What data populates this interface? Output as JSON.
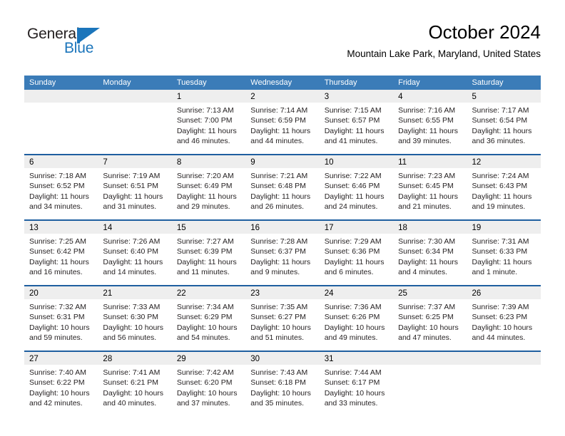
{
  "brand": {
    "name_part1": "General",
    "name_part2": "Blue",
    "flag_icon": "general-blue-flag-logo",
    "color_dark": "#231f20",
    "color_blue": "#1b75bb"
  },
  "header": {
    "title": "October 2024",
    "subtitle": "Mountain Lake Park, Maryland, United States"
  },
  "theme": {
    "header_blue": "#3b7cb8",
    "row_divider_blue": "#1f5fa0",
    "day_strip_gray": "#eeeeee"
  },
  "weekdays": [
    "Sunday",
    "Monday",
    "Tuesday",
    "Wednesday",
    "Thursday",
    "Friday",
    "Saturday"
  ],
  "weeks": [
    [
      {
        "day": "",
        "sunrise": "",
        "sunset": "",
        "daylight_1": "",
        "daylight_2": ""
      },
      {
        "day": "",
        "sunrise": "",
        "sunset": "",
        "daylight_1": "",
        "daylight_2": ""
      },
      {
        "day": "1",
        "sunrise": "Sunrise: 7:13 AM",
        "sunset": "Sunset: 7:00 PM",
        "daylight_1": "Daylight: 11 hours",
        "daylight_2": "and 46 minutes."
      },
      {
        "day": "2",
        "sunrise": "Sunrise: 7:14 AM",
        "sunset": "Sunset: 6:59 PM",
        "daylight_1": "Daylight: 11 hours",
        "daylight_2": "and 44 minutes."
      },
      {
        "day": "3",
        "sunrise": "Sunrise: 7:15 AM",
        "sunset": "Sunset: 6:57 PM",
        "daylight_1": "Daylight: 11 hours",
        "daylight_2": "and 41 minutes."
      },
      {
        "day": "4",
        "sunrise": "Sunrise: 7:16 AM",
        "sunset": "Sunset: 6:55 PM",
        "daylight_1": "Daylight: 11 hours",
        "daylight_2": "and 39 minutes."
      },
      {
        "day": "5",
        "sunrise": "Sunrise: 7:17 AM",
        "sunset": "Sunset: 6:54 PM",
        "daylight_1": "Daylight: 11 hours",
        "daylight_2": "and 36 minutes."
      }
    ],
    [
      {
        "day": "6",
        "sunrise": "Sunrise: 7:18 AM",
        "sunset": "Sunset: 6:52 PM",
        "daylight_1": "Daylight: 11 hours",
        "daylight_2": "and 34 minutes."
      },
      {
        "day": "7",
        "sunrise": "Sunrise: 7:19 AM",
        "sunset": "Sunset: 6:51 PM",
        "daylight_1": "Daylight: 11 hours",
        "daylight_2": "and 31 minutes."
      },
      {
        "day": "8",
        "sunrise": "Sunrise: 7:20 AM",
        "sunset": "Sunset: 6:49 PM",
        "daylight_1": "Daylight: 11 hours",
        "daylight_2": "and 29 minutes."
      },
      {
        "day": "9",
        "sunrise": "Sunrise: 7:21 AM",
        "sunset": "Sunset: 6:48 PM",
        "daylight_1": "Daylight: 11 hours",
        "daylight_2": "and 26 minutes."
      },
      {
        "day": "10",
        "sunrise": "Sunrise: 7:22 AM",
        "sunset": "Sunset: 6:46 PM",
        "daylight_1": "Daylight: 11 hours",
        "daylight_2": "and 24 minutes."
      },
      {
        "day": "11",
        "sunrise": "Sunrise: 7:23 AM",
        "sunset": "Sunset: 6:45 PM",
        "daylight_1": "Daylight: 11 hours",
        "daylight_2": "and 21 minutes."
      },
      {
        "day": "12",
        "sunrise": "Sunrise: 7:24 AM",
        "sunset": "Sunset: 6:43 PM",
        "daylight_1": "Daylight: 11 hours",
        "daylight_2": "and 19 minutes."
      }
    ],
    [
      {
        "day": "13",
        "sunrise": "Sunrise: 7:25 AM",
        "sunset": "Sunset: 6:42 PM",
        "daylight_1": "Daylight: 11 hours",
        "daylight_2": "and 16 minutes."
      },
      {
        "day": "14",
        "sunrise": "Sunrise: 7:26 AM",
        "sunset": "Sunset: 6:40 PM",
        "daylight_1": "Daylight: 11 hours",
        "daylight_2": "and 14 minutes."
      },
      {
        "day": "15",
        "sunrise": "Sunrise: 7:27 AM",
        "sunset": "Sunset: 6:39 PM",
        "daylight_1": "Daylight: 11 hours",
        "daylight_2": "and 11 minutes."
      },
      {
        "day": "16",
        "sunrise": "Sunrise: 7:28 AM",
        "sunset": "Sunset: 6:37 PM",
        "daylight_1": "Daylight: 11 hours",
        "daylight_2": "and 9 minutes."
      },
      {
        "day": "17",
        "sunrise": "Sunrise: 7:29 AM",
        "sunset": "Sunset: 6:36 PM",
        "daylight_1": "Daylight: 11 hours",
        "daylight_2": "and 6 minutes."
      },
      {
        "day": "18",
        "sunrise": "Sunrise: 7:30 AM",
        "sunset": "Sunset: 6:34 PM",
        "daylight_1": "Daylight: 11 hours",
        "daylight_2": "and 4 minutes."
      },
      {
        "day": "19",
        "sunrise": "Sunrise: 7:31 AM",
        "sunset": "Sunset: 6:33 PM",
        "daylight_1": "Daylight: 11 hours",
        "daylight_2": "and 1 minute."
      }
    ],
    [
      {
        "day": "20",
        "sunrise": "Sunrise: 7:32 AM",
        "sunset": "Sunset: 6:31 PM",
        "daylight_1": "Daylight: 10 hours",
        "daylight_2": "and 59 minutes."
      },
      {
        "day": "21",
        "sunrise": "Sunrise: 7:33 AM",
        "sunset": "Sunset: 6:30 PM",
        "daylight_1": "Daylight: 10 hours",
        "daylight_2": "and 56 minutes."
      },
      {
        "day": "22",
        "sunrise": "Sunrise: 7:34 AM",
        "sunset": "Sunset: 6:29 PM",
        "daylight_1": "Daylight: 10 hours",
        "daylight_2": "and 54 minutes."
      },
      {
        "day": "23",
        "sunrise": "Sunrise: 7:35 AM",
        "sunset": "Sunset: 6:27 PM",
        "daylight_1": "Daylight: 10 hours",
        "daylight_2": "and 51 minutes."
      },
      {
        "day": "24",
        "sunrise": "Sunrise: 7:36 AM",
        "sunset": "Sunset: 6:26 PM",
        "daylight_1": "Daylight: 10 hours",
        "daylight_2": "and 49 minutes."
      },
      {
        "day": "25",
        "sunrise": "Sunrise: 7:37 AM",
        "sunset": "Sunset: 6:25 PM",
        "daylight_1": "Daylight: 10 hours",
        "daylight_2": "and 47 minutes."
      },
      {
        "day": "26",
        "sunrise": "Sunrise: 7:39 AM",
        "sunset": "Sunset: 6:23 PM",
        "daylight_1": "Daylight: 10 hours",
        "daylight_2": "and 44 minutes."
      }
    ],
    [
      {
        "day": "27",
        "sunrise": "Sunrise: 7:40 AM",
        "sunset": "Sunset: 6:22 PM",
        "daylight_1": "Daylight: 10 hours",
        "daylight_2": "and 42 minutes."
      },
      {
        "day": "28",
        "sunrise": "Sunrise: 7:41 AM",
        "sunset": "Sunset: 6:21 PM",
        "daylight_1": "Daylight: 10 hours",
        "daylight_2": "and 40 minutes."
      },
      {
        "day": "29",
        "sunrise": "Sunrise: 7:42 AM",
        "sunset": "Sunset: 6:20 PM",
        "daylight_1": "Daylight: 10 hours",
        "daylight_2": "and 37 minutes."
      },
      {
        "day": "30",
        "sunrise": "Sunrise: 7:43 AM",
        "sunset": "Sunset: 6:18 PM",
        "daylight_1": "Daylight: 10 hours",
        "daylight_2": "and 35 minutes."
      },
      {
        "day": "31",
        "sunrise": "Sunrise: 7:44 AM",
        "sunset": "Sunset: 6:17 PM",
        "daylight_1": "Daylight: 10 hours",
        "daylight_2": "and 33 minutes."
      },
      {
        "day": "",
        "sunrise": "",
        "sunset": "",
        "daylight_1": "",
        "daylight_2": ""
      },
      {
        "day": "",
        "sunrise": "",
        "sunset": "",
        "daylight_1": "",
        "daylight_2": ""
      }
    ]
  ]
}
